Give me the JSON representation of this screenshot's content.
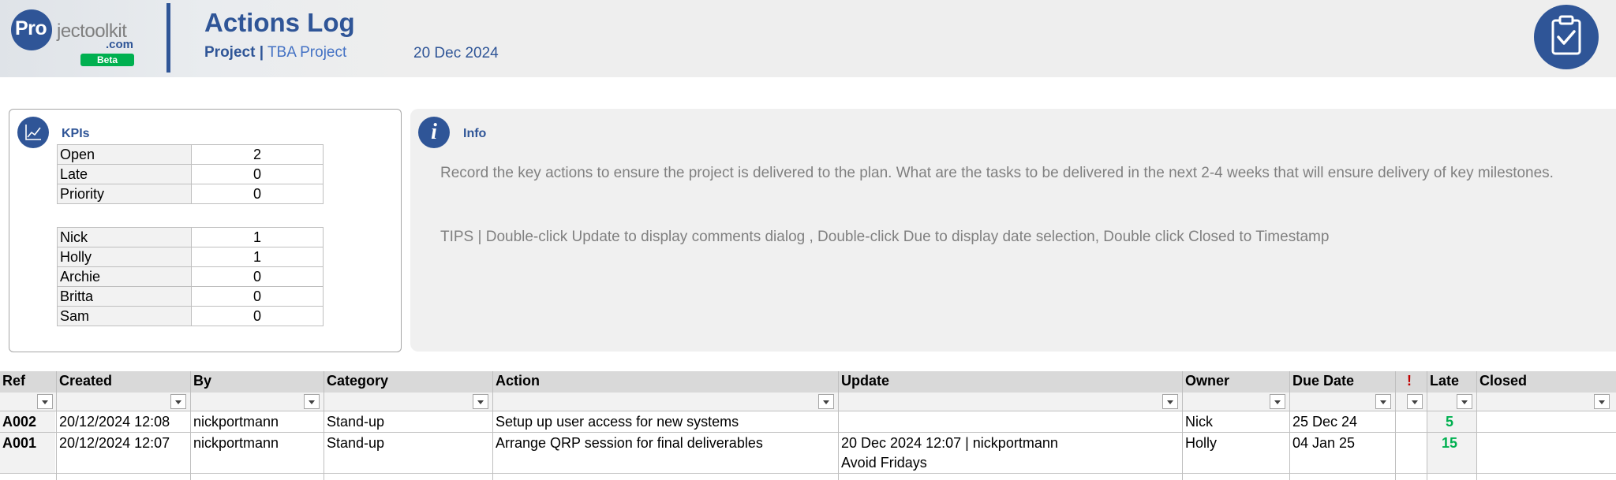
{
  "brand": {
    "logo_pro": "Pro",
    "logo_rest": "jectoolkit",
    "logo_com": ".com",
    "logo_badge": "Beta"
  },
  "header": {
    "title": "Actions Log",
    "project_key": "Project |",
    "project_name": "TBA Project",
    "date": "20 Dec 2024",
    "app_icon": "clipboard-check-icon"
  },
  "kpis": {
    "title": "KPIs",
    "icon": "line-chart-icon",
    "status": [
      {
        "label": "Open",
        "value": "2"
      },
      {
        "label": "Late",
        "value": "0"
      },
      {
        "label": "Priority",
        "value": "0"
      }
    ],
    "owners": [
      {
        "label": "Nick",
        "value": "1"
      },
      {
        "label": "Holly",
        "value": "1"
      },
      {
        "label": "Archie",
        "value": "0"
      },
      {
        "label": "Britta",
        "value": "0"
      },
      {
        "label": "Sam",
        "value": "0"
      }
    ]
  },
  "info": {
    "title": "Info",
    "icon": "info-icon",
    "text": "Record the key actions to ensure the project is delivered to the plan.  What are the tasks to be delivered in the next 2-4 weeks that will ensure delivery of key milestones.",
    "tips": "TIPS | Double-click Update to display comments dialog , Double-click Due to display date selection, Double click Closed to Timestamp"
  },
  "table": {
    "columns": {
      "ref": "Ref",
      "created": "Created",
      "by": "By",
      "category": "Category",
      "action": "Action",
      "update": "Update",
      "owner": "Owner",
      "due": "Due Date",
      "priority": "!",
      "late": "Late",
      "closed": "Closed"
    },
    "rows": [
      {
        "ref": "A002",
        "created": "20/12/2024 12:08",
        "by": "nickportmann",
        "category": "Stand-up",
        "action": "Setup up user access for new systems",
        "update_line1": "",
        "update_line2": "",
        "owner": "Nick",
        "due": "25 Dec 24",
        "priority": "",
        "late": "5",
        "closed": ""
      },
      {
        "ref": "A001",
        "created": "20/12/2024 12:07",
        "by": "nickportmann",
        "category": "Stand-up",
        "action": "Arrange QRP session for final deliverables",
        "update_line1": "20 Dec 2024 12:07 | nickportmann",
        "update_line2": "Avoid Fridays",
        "owner": "Holly",
        "due": "04 Jan 25",
        "priority": "",
        "late": "15",
        "closed": ""
      }
    ]
  },
  "colors": {
    "brand_blue": "#2f5597",
    "accent_blue": "#4472c4",
    "beta_green": "#00b050",
    "late_green": "#00b050",
    "priority_red": "#c00000"
  }
}
